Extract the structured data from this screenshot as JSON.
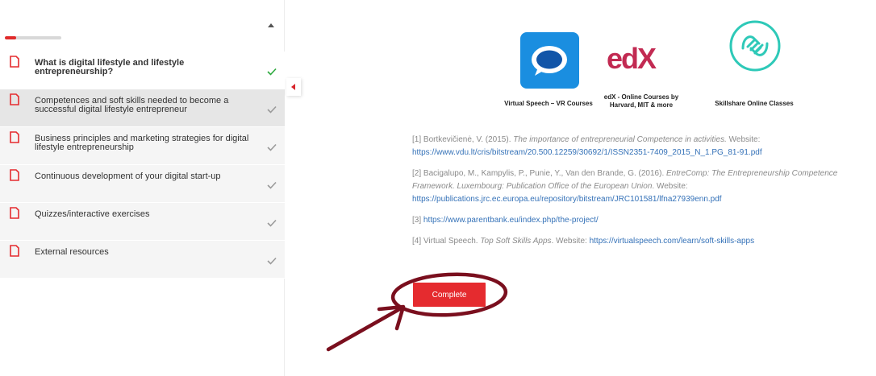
{
  "progress": {
    "percent": 20
  },
  "lessons": [
    {
      "title": "What is digital lifestyle and lifestyle entrepreneurship?",
      "status": "completed"
    },
    {
      "title": "Competences and soft skills needed to become a successful digital lifestyle entrepreneur",
      "status": "active"
    },
    {
      "title": "Business principles and marketing strategies for digital lifestyle entrepreneurship",
      "status": "pending"
    },
    {
      "title": "Continuous development of your digital start-up",
      "status": "pending"
    },
    {
      "title": "Quizzes/interactive exercises",
      "status": "pending"
    },
    {
      "title": "External resources",
      "status": "pending"
    }
  ],
  "apps": [
    {
      "label": "Virtual Speech – VR Courses",
      "icon": "chat-bubble-logo"
    },
    {
      "label_line1": "edX - Online Courses by",
      "label_line2": "Harvard, MIT & more",
      "logo_text": "edX",
      "icon": "edx-logo"
    },
    {
      "label": "Skillshare Online Classes",
      "icon": "hands-logo"
    }
  ],
  "references": [
    {
      "prefix": "[1] Bortkevičienė, V. (2015). ",
      "title": "The importance of entrepreneurial Competence in activities.",
      "mid": " Website: ",
      "link": "https://www.vdu.lt/cris/bitstream/20.500.12259/30692/1/ISSN2351-7409_2015_N_1.PG_81-91.pdf"
    },
    {
      "prefix": "[2]  Bacigalupo, M., Kampylis, P., Punie, Y., Van den Brande, G. (2016). ",
      "title": "EntreComp: The Entrepreneurship Competence Framework. Luxembourg: Publication Office of the European Union",
      "mid": ". Website: ",
      "link": "https://publications.jrc.ec.europa.eu/repository/bitstream/JRC101581/lfna27939enn.pdf"
    },
    {
      "prefix": "[3] ",
      "title": "",
      "mid": "",
      "link": "https://www.parentbank.eu/index.php/the-project/"
    },
    {
      "prefix": "[4] Virtual Speech. ",
      "title": "Top Soft Skills Apps",
      "mid": ". Website: ",
      "link": "https://virtualspeech.com/learn/soft-skills-apps"
    }
  ],
  "complete_button": {
    "label": "Complete"
  },
  "colors": {
    "accent": "#e52b2f",
    "link": "#3572b8",
    "check_done": "#2eaa3f",
    "check_pending": "#9a9a9a",
    "annotation": "#7a0f1e"
  }
}
